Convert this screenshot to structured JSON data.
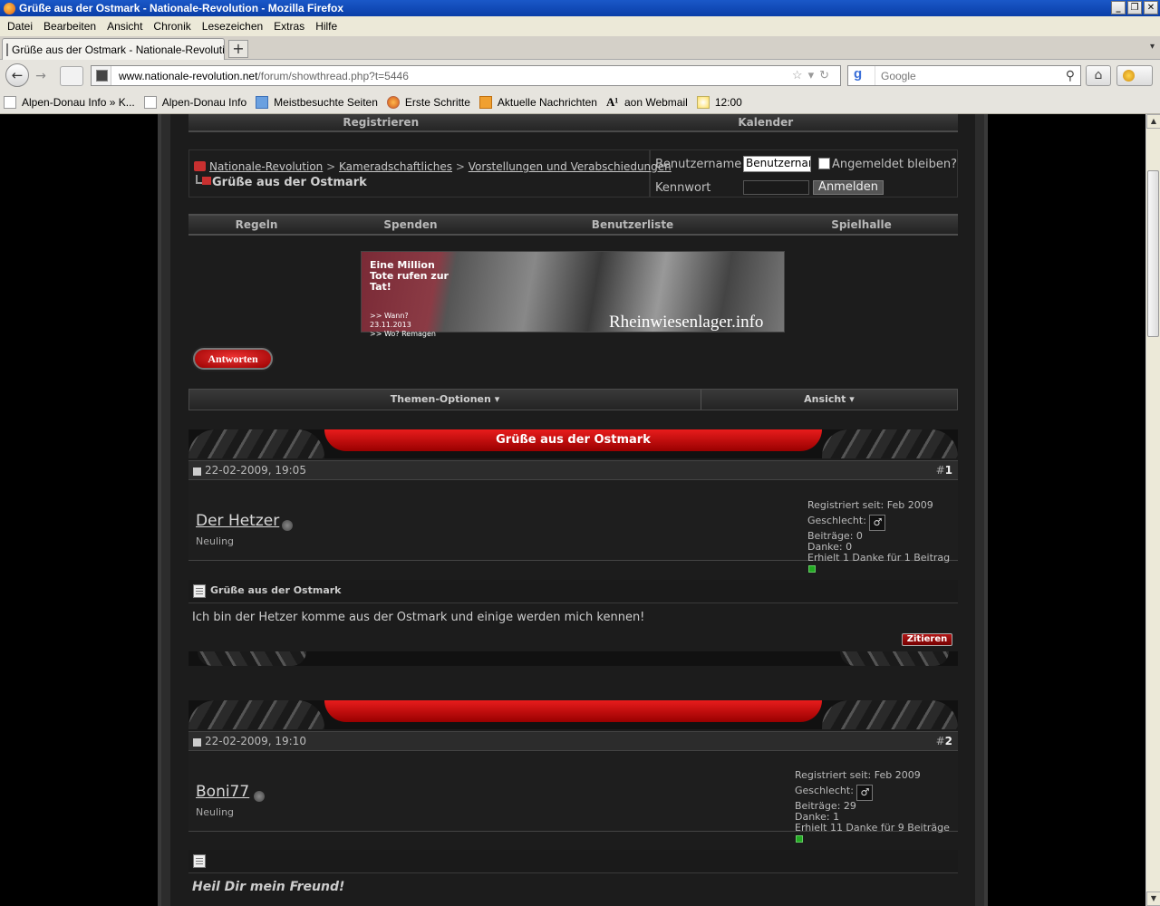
{
  "window": {
    "title": "Grüße aus der Ostmark - Nationale-Revolution - Mozilla Firefox",
    "buttons": [
      "_",
      "❐",
      "✕"
    ]
  },
  "menu": [
    "Datei",
    "Bearbeiten",
    "Ansicht",
    "Chronik",
    "Lesezeichen",
    "Extras",
    "Hilfe"
  ],
  "tab": {
    "title": "Grüße aus der Ostmark - Nationale-Revolution",
    "new_tab": "+"
  },
  "nav": {
    "url_host": "www.nationale-revolution.net",
    "url_path": "/forum/showthread.php?t=5446",
    "search_placeholder": "Google"
  },
  "bookmarks": [
    {
      "label": "Alpen-Donau Info » K...",
      "icon": "page-icon"
    },
    {
      "label": "Alpen-Donau Info",
      "icon": "page-icon"
    },
    {
      "label": "Meistbesuchte Seiten",
      "icon": "star-folder-icon"
    },
    {
      "label": "Erste Schritte",
      "icon": "firefox-icon"
    },
    {
      "label": "Aktuelle Nachrichten",
      "icon": "rss-icon"
    },
    {
      "label": "aon Webmail",
      "icon": "aon-icon"
    },
    {
      "label": "12:00",
      "icon": "weather-icon"
    }
  ],
  "forum": {
    "topnav": [
      "Registrieren",
      "Kalender"
    ],
    "breadcrumb": [
      "Nationale-Revolution",
      "Kameradschaftliches",
      "Vorstellungen und Verabschiedungen"
    ],
    "breadcrumb_sep": ">",
    "thread_title": "Grüße aus der Ostmark",
    "login": {
      "username_label": "Benutzername",
      "username_value": "Benutzername",
      "remember_label": "Angemeldet bleiben?",
      "password_label": "Kennwort",
      "submit": "Anmelden"
    },
    "navbar": [
      "Regeln",
      "Spenden",
      "Benutzerliste",
      "Spielhalle"
    ],
    "banner": {
      "headline": "Eine Million Tote rufen zur Tat!",
      "when": ">> Wann? 23.11.2013",
      "where": ">> Wo? Remagen",
      "site": "Rheinwiesenlager.info"
    },
    "reply_button": "Antworten",
    "thread_options": "Themen-Optionen",
    "view_options": "Ansicht",
    "posts": [
      {
        "header": "Grüße aus der Ostmark",
        "date": "22-02-2009, 19:05",
        "number_prefix": "#",
        "number": "1",
        "username": "Der Hetzer",
        "rank": "Neuling",
        "registered": "Registriert seit: Feb 2009",
        "gender_label": "Geschlecht:",
        "gender_symbol": "♂",
        "posts_count": "Beiträge: 0",
        "thanks": "Danke: 0",
        "received": "Erhielt 1 Danke für 1 Beitrag",
        "title": "Grüße aus der Ostmark",
        "body": "Ich bin der Hetzer komme aus der Ostmark und einige werden mich kennen!",
        "quote": "Zitieren"
      },
      {
        "header": "",
        "date": "22-02-2009, 19:10",
        "number_prefix": "#",
        "number": "2",
        "username": "Boni77",
        "rank": "Neuling",
        "registered": "Registriert seit: Feb 2009",
        "gender_label": "Geschlecht:",
        "gender_symbol": "♂",
        "posts_count": "Beiträge: 29",
        "thanks": "Danke: 1",
        "received": "Erhielt 11 Danke für 9 Beiträge",
        "title": "",
        "body": "Heil Dir mein Freund!"
      }
    ]
  }
}
